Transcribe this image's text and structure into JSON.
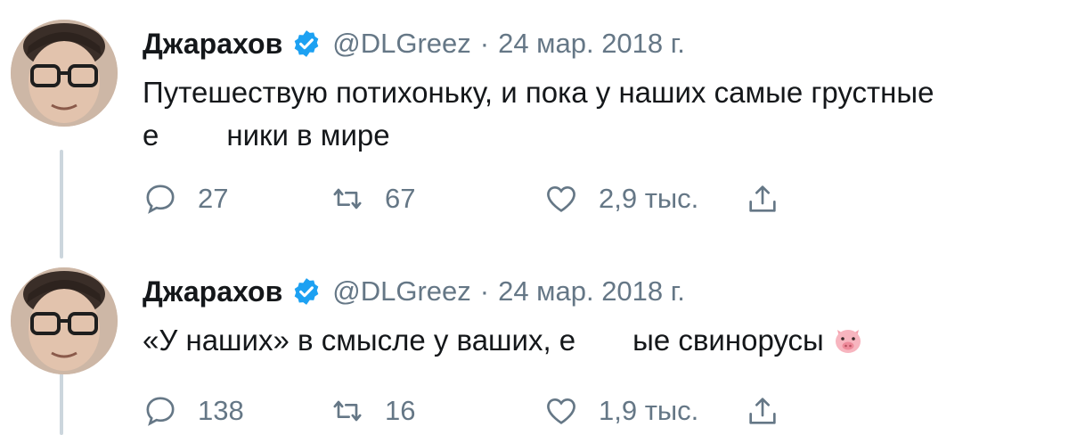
{
  "colors": {
    "text": "#14171a",
    "muted": "#657786",
    "verified": "#1da1f2",
    "thread_line": "#ccd6dd"
  },
  "tweets": [
    {
      "author_name": "Джарахов",
      "handle": "@DLGreez",
      "separator": "·",
      "date": "24 мар. 2018 г.",
      "text_line1": "Путешествую потихоньку, и пока у наших самые грустные",
      "text_line2_start": "е",
      "text_line2_end": "ники в мире",
      "replies": "27",
      "retweets": "67",
      "likes": "2,9 тыс."
    },
    {
      "author_name": "Джарахов",
      "handle": "@DLGreez",
      "separator": "·",
      "date": "24 мар. 2018 г.",
      "text_start": "«У наших» в смысле у ваших, е",
      "text_end": "ые свинорусы",
      "emoji": "pig-face-emoji",
      "replies": "138",
      "retweets": "16",
      "likes": "1,9 тыс."
    }
  ],
  "icons": {
    "reply": "reply-icon",
    "retweet": "retweet-icon",
    "like": "heart-icon",
    "share": "share-icon",
    "verified": "verified-badge-icon"
  }
}
